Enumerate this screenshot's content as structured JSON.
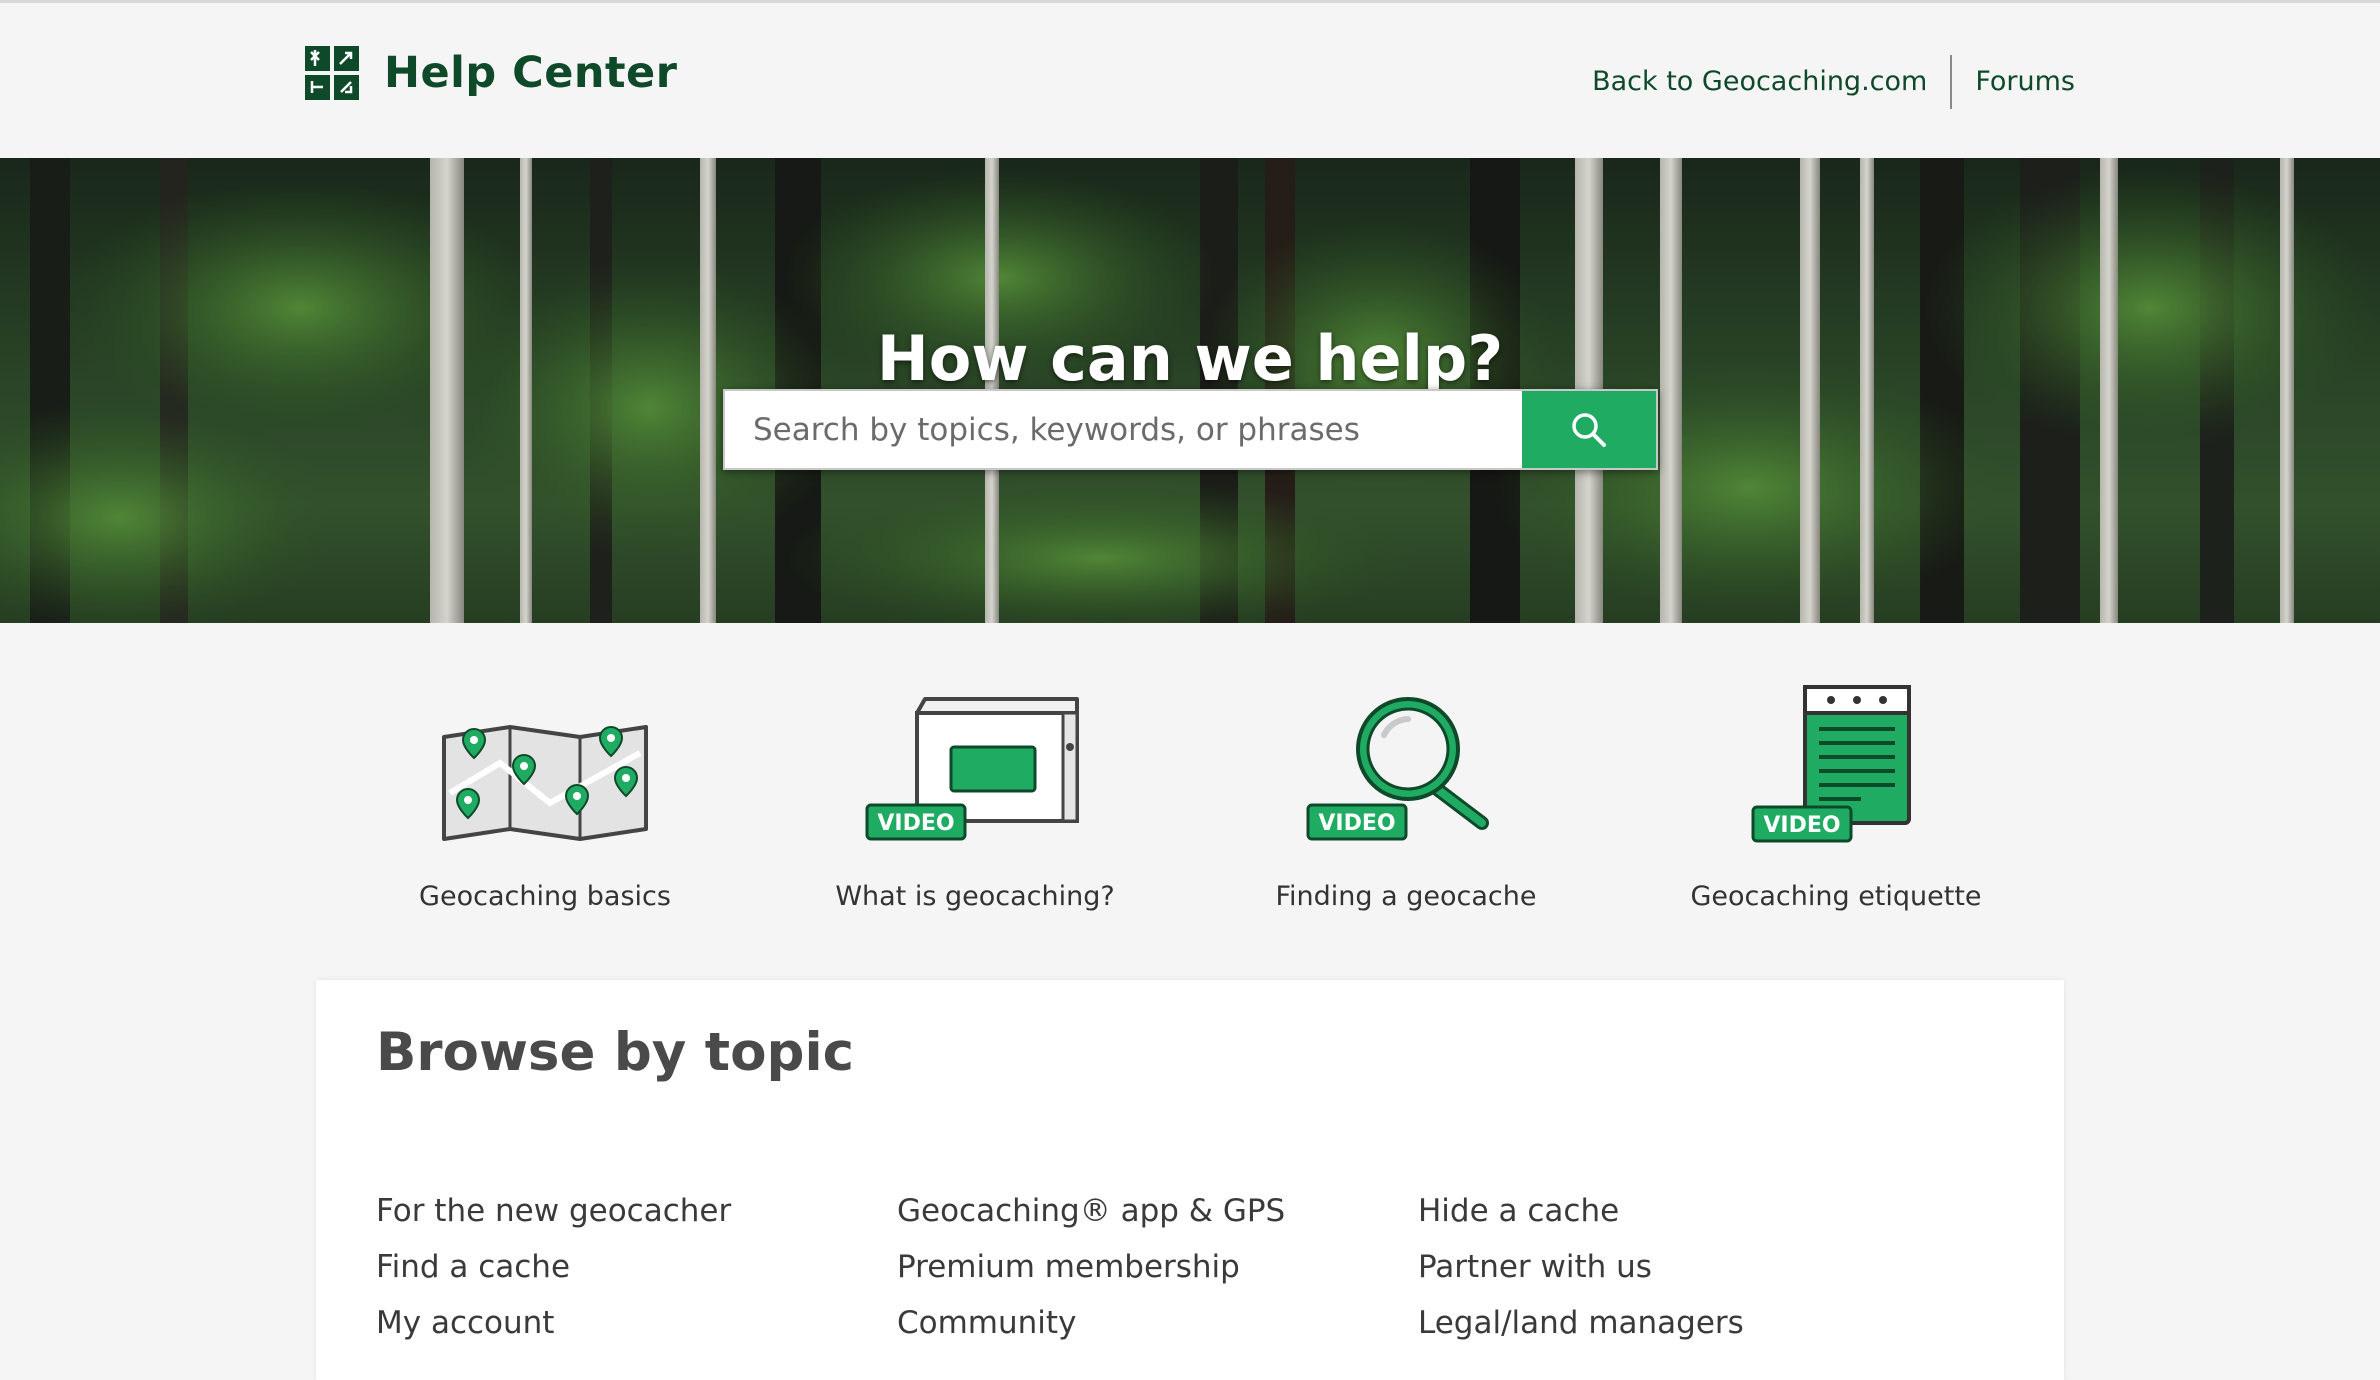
{
  "header": {
    "title": "Help Center",
    "logo_icon": "geocaching-logo-icon",
    "nav": [
      {
        "label": "Back to Geocaching.com"
      },
      {
        "label": "Forums"
      }
    ]
  },
  "hero": {
    "title": "How can we help?",
    "search_placeholder": "Search by topics, keywords, or phrases",
    "search_icon": "search-icon"
  },
  "features": [
    {
      "label": "Geocaching basics",
      "icon": "map-pins-icon"
    },
    {
      "label": "What is geocaching?",
      "icon": "ammo-box-icon",
      "badge": "VIDEO"
    },
    {
      "label": "Finding a geocache",
      "icon": "magnifier-icon",
      "badge": "VIDEO"
    },
    {
      "label": "Geocaching etiquette",
      "icon": "notepad-icon",
      "badge": "VIDEO"
    }
  ],
  "topics": {
    "heading": "Browse by topic",
    "columns": [
      [
        "For the new geocacher",
        "Find a cache",
        "My account"
      ],
      [
        "Geocaching® app & GPS",
        "Premium membership",
        "Community"
      ],
      [
        "Hide a cache",
        "Partner with us",
        "Legal/land managers"
      ]
    ]
  },
  "colors": {
    "brand_dark_green": "#0e4a2a",
    "accent_green": "#1fac62",
    "page_background": "#f5f5f5"
  }
}
